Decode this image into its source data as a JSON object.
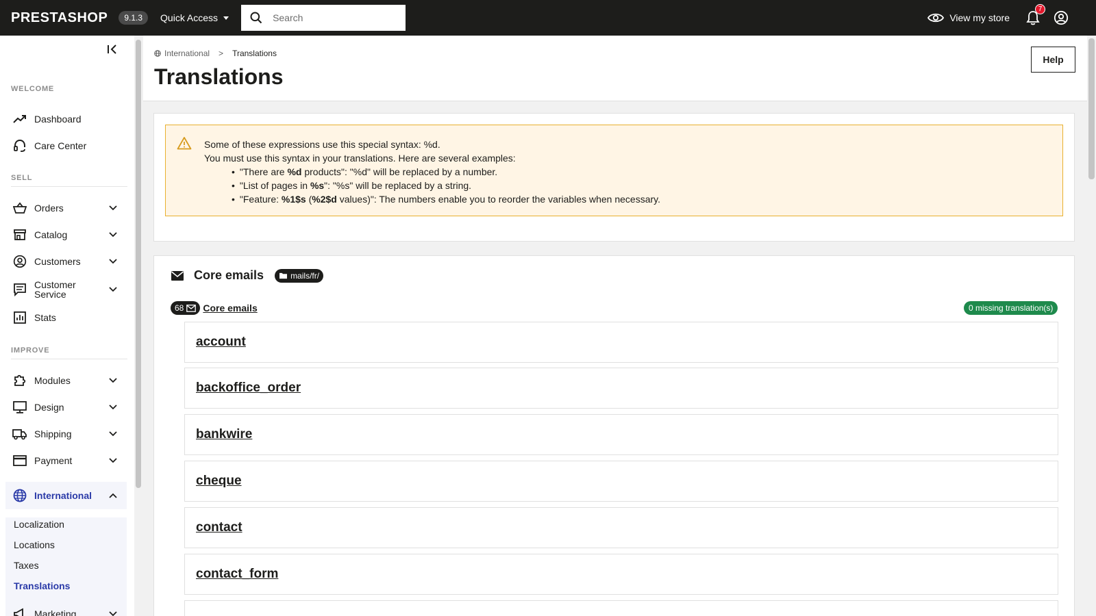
{
  "header": {
    "logo": "PRESTASHOP",
    "version": "9.1.3",
    "quick_access": "Quick Access",
    "search_placeholder": "Search",
    "view_store": "View my store",
    "notifications_count": "7"
  },
  "sidebar": {
    "sections": {
      "welcome": "WELCOME",
      "sell": "SELL",
      "improve": "IMPROVE"
    },
    "items": {
      "dashboard": "Dashboard",
      "care_center": "Care Center",
      "orders": "Orders",
      "catalog": "Catalog",
      "customers": "Customers",
      "customer_service_1": "Customer",
      "customer_service_2": "Service",
      "stats": "Stats",
      "modules": "Modules",
      "design": "Design",
      "shipping": "Shipping",
      "payment": "Payment",
      "international": "International",
      "marketing": "Marketing"
    },
    "international_sub": {
      "localization": "Localization",
      "locations": "Locations",
      "taxes": "Taxes",
      "translations": "Translations"
    }
  },
  "page": {
    "breadcrumb_parent": "International",
    "breadcrumb_sep": ">",
    "breadcrumb_current": "Translations",
    "title": "Translations",
    "help": "Help"
  },
  "alert": {
    "line1": "Some of these expressions use this special syntax: %d.",
    "line2": "You must use this syntax in your translations. Here are several examples:",
    "ex1": {
      "a": "\"There are ",
      "b": "%d",
      "c": " products\": \"%d\" will be replaced by a number."
    },
    "ex2": {
      "a": "\"List of pages in ",
      "b": "%s",
      "c": "\": \"%s\" will be replaced by a string."
    },
    "ex3": {
      "a": "\"Feature: ",
      "b": "%1$s",
      "c": " (",
      "d": "%2$d",
      "e": " values)\": The numbers enable you to reorder the variables when necessary."
    }
  },
  "emails": {
    "title": "Core emails",
    "path": "mails/fr/",
    "count": "68",
    "link": "Core emails",
    "missing": "0 missing translation(s)",
    "folders": [
      "account",
      "backoffice_order",
      "bankwire",
      "cheque",
      "contact",
      "contact_form"
    ]
  }
}
